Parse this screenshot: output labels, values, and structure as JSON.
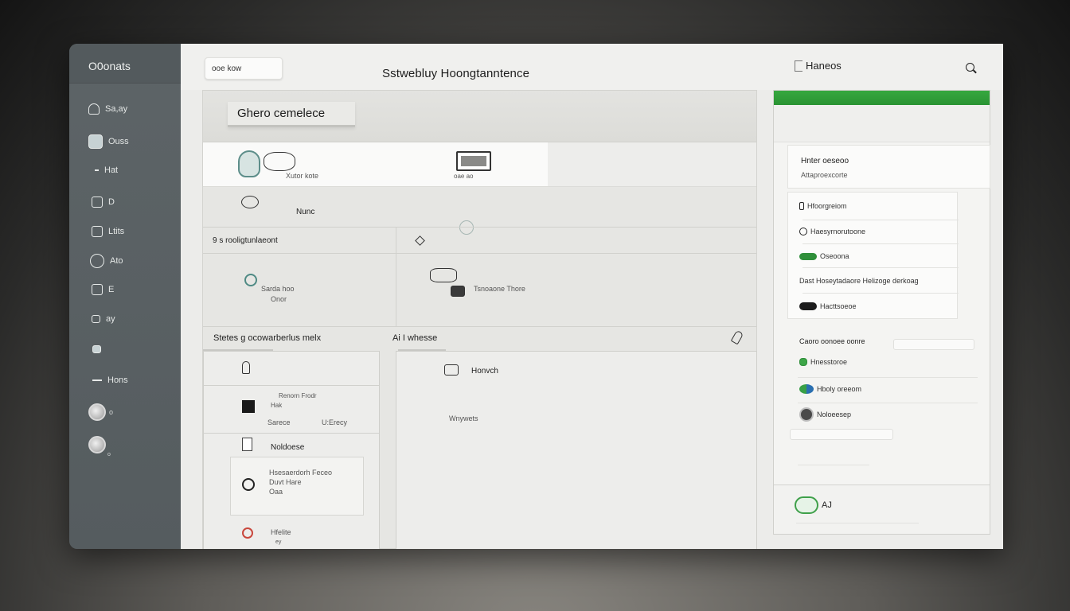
{
  "sidebar": {
    "title": "O0onats",
    "items": [
      {
        "label": "Sa,ay",
        "icon": "cloud-icon"
      },
      {
        "label": "Ouss",
        "icon": "folder-icon"
      },
      {
        "label": "Hat",
        "icon": "minus-icon"
      },
      {
        "label": "D",
        "icon": "chart-icon"
      },
      {
        "label": "Ltits",
        "icon": "calendar-icon"
      },
      {
        "label": "Ato",
        "icon": "user-icon"
      },
      {
        "label": "E",
        "icon": "box-icon"
      },
      {
        "label": "ay",
        "icon": "lock-icon"
      },
      {
        "label": "",
        "icon": "bag-icon"
      },
      {
        "label": "Hons",
        "icon": "dash-icon"
      }
    ],
    "avatar_captions": [
      "o",
      "o"
    ]
  },
  "topbar": {
    "pill_label": "ooe kow",
    "heading": "Sstwebluy Hoongtanntence",
    "right_label": "Haneos"
  },
  "panel": {
    "tab_label": "Ghero cemelece",
    "row1_left_caption": "Xutor kote",
    "row1_right_caption": "oae ao",
    "row2_label": "Nunc",
    "grid_left_header": "9 s rooligtunlaeont",
    "grid_left_text1": "Sarda hoo",
    "grid_left_text2": "Onor",
    "grid_right_text": "Tsnoaone Thore",
    "section_left": "Stetes g ocowarberlus melx",
    "section_right": "Ai I whesse",
    "list": [
      {
        "line1": "Renorn Frodr",
        "line2": "Hak",
        "sub1": "Sarece",
        "sub2": "U:Erecy"
      },
      {
        "line1": "Noldoese"
      },
      {
        "line1": "Hsesaerdorh Feceo",
        "line2": "Duvt Hare",
        "line3": "Oaa"
      },
      {
        "line1": "Hfelite",
        "line2": "ey"
      }
    ],
    "detail_title": "Honvch",
    "detail_sub": "Wnywets"
  },
  "rpanel": {
    "card_title": "Hnter oeseoo",
    "card_sub": "Attaproexcorte",
    "items": [
      {
        "label": "Hfoorgreiom"
      },
      {
        "label": "Haesyrnorutoone"
      },
      {
        "label": "Oseoona"
      },
      {
        "label": "Dast Hoseytadaore Helizoge derkoag"
      },
      {
        "label": "Hacttsoeoe"
      }
    ],
    "section_label": "Caoro oonoee oonre",
    "section_items": [
      {
        "label": "Hnesstoroe"
      },
      {
        "label": "Hboly oreeom"
      },
      {
        "label": "Noloeesep"
      }
    ],
    "footer_label": "AJ"
  },
  "colors": {
    "accent": "#2f9a38",
    "sidebar": "#5a6164",
    "background": "#ececea"
  }
}
